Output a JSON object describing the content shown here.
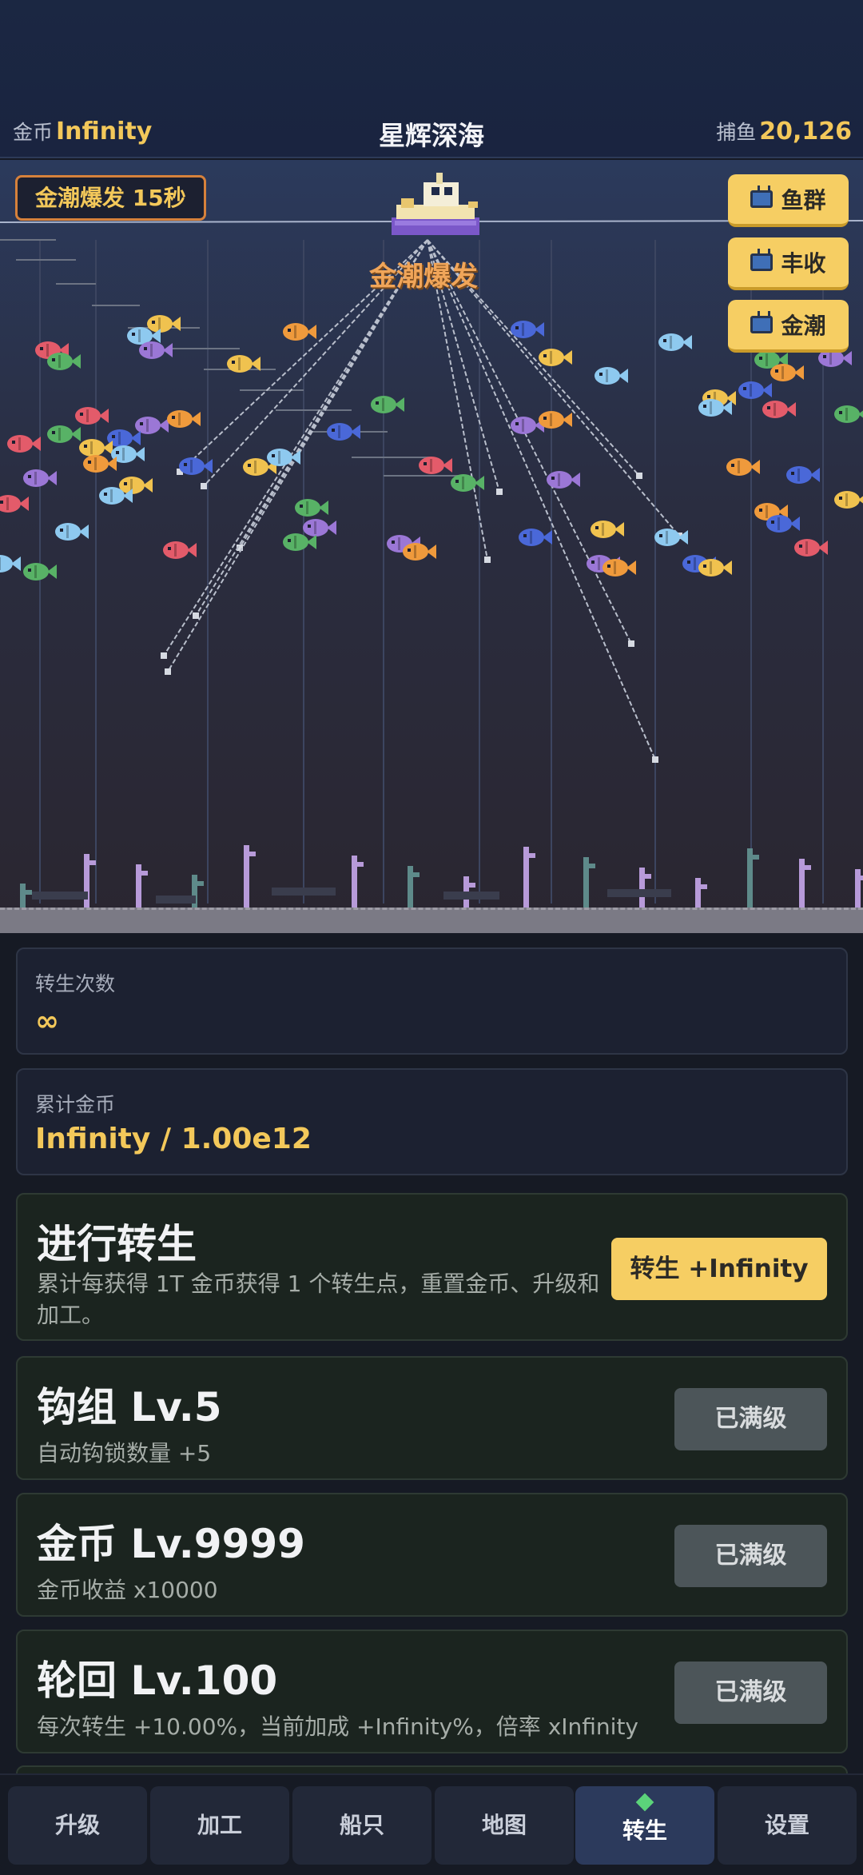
{
  "header": {
    "coins_label": "金币",
    "coins_value": "Infinity",
    "title": "星辉深海",
    "catch_label": "捕鱼",
    "catch_value": "20,126"
  },
  "sea": {
    "gold_badge": "金潮爆发 15秒",
    "event_text": "金潮爆发",
    "boosts": [
      {
        "label": "鱼群",
        "icon": "tv-icon"
      },
      {
        "label": "丰收",
        "icon": "tv-icon"
      },
      {
        "label": "金潮",
        "icon": "tv-icon"
      }
    ]
  },
  "stats": {
    "rebirth_count_label": "转生次数",
    "rebirth_count_value": "∞",
    "total_coins_label": "累计金币",
    "total_coins_value": "Infinity / 1.00e12"
  },
  "rebirth": {
    "title": "进行转生",
    "desc": "累计每获得 1T 金币获得 1 个转生点，重置金币、升级和加工。",
    "button": "转生 +Infinity"
  },
  "upgrades": [
    {
      "title": "钩组 Lv.5",
      "desc": "自动钩锁数量 +5",
      "button": "已满级"
    },
    {
      "title": "金币 Lv.9999",
      "desc": "金币收益 x10000",
      "button": "已满级"
    },
    {
      "title": "轮回 Lv.100",
      "desc": "每次转生 +10.00%，当前加成 +Infinity%，倍率 xInfinity",
      "button": "已满级"
    }
  ],
  "nav": {
    "tabs": [
      "升级",
      "加工",
      "船只",
      "地图",
      "转生",
      "设置"
    ],
    "active": "转生"
  },
  "colors": {
    "accent_gold": "#f6ce63",
    "background": "#161a24",
    "active_tab": "#2c3a5c"
  }
}
